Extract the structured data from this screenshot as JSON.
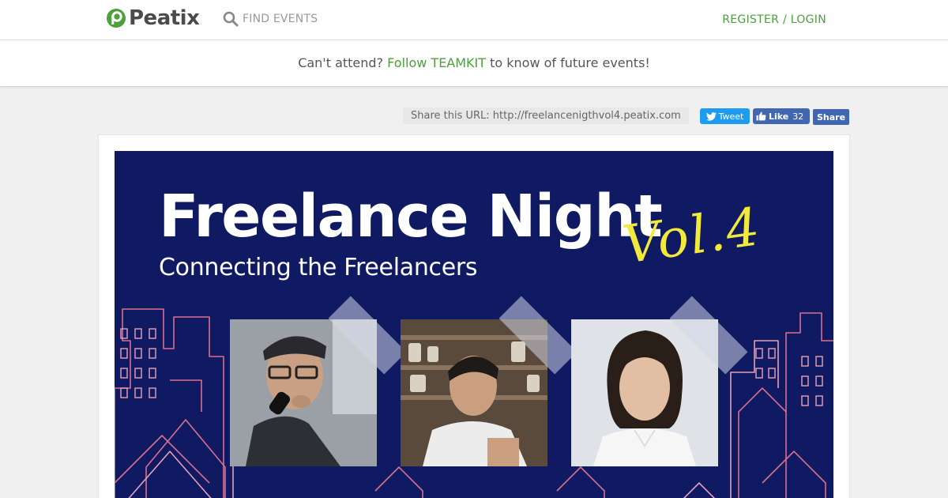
{
  "header": {
    "brand": "Peatix",
    "search_label": "FIND EVENTS",
    "login_label": "REGISTER / LOGIN",
    "colors": {
      "brand_green": "#4ea03d",
      "logo_text": "#4b4b4b"
    }
  },
  "notice": {
    "before": "Can't attend?",
    "link": "Follow TEAMKIT",
    "after": "to know of future events!"
  },
  "share": {
    "url_text": "Share this URL: http://freelancenigthvol4.peatix.com",
    "tweet_label": "Tweet",
    "like_label": "Like",
    "like_count": "32",
    "share_label": "Share",
    "colors": {
      "twitter": "#1d9bf0",
      "facebook": "#4267b2"
    }
  },
  "banner": {
    "title": "Freelance Night",
    "subtitle": "Connecting the Freelancers",
    "volume": "Vol.4",
    "colors": {
      "background": "#0f1a63",
      "volume": "#f2ea3a"
    }
  },
  "icons": {
    "logo": "peatix-logo-icon",
    "search": "search-icon",
    "tweet": "twitter-bird-icon",
    "like": "thumbs-up-icon"
  }
}
